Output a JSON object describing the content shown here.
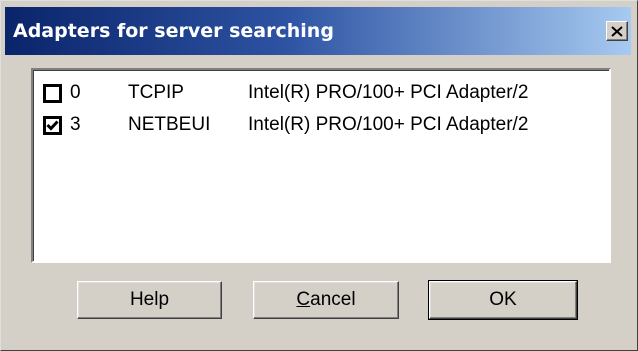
{
  "dialog": {
    "title": "Adapters for server searching",
    "close_icon": "close-icon"
  },
  "adapters": [
    {
      "checked": false,
      "number": "0",
      "protocol": "TCPIP",
      "adapter": "Intel(R) PRO/100+ PCI Adapter/2"
    },
    {
      "checked": true,
      "number": "3",
      "protocol": "NETBEUI",
      "adapter": "Intel(R) PRO/100+ PCI Adapter/2"
    }
  ],
  "buttons": {
    "help": "Help",
    "cancel_mnemonic": "C",
    "cancel_rest": "ancel",
    "ok": "OK"
  },
  "colors": {
    "titlebar_start": "#0a246a",
    "titlebar_end": "#a6caf0",
    "face": "#d4d0c8"
  }
}
